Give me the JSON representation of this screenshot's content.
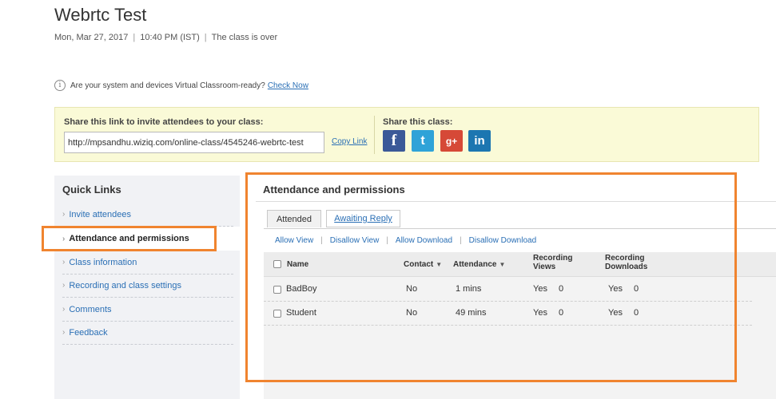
{
  "header": {
    "title": "Webrtc Test",
    "date": "Mon, Mar 27, 2017",
    "time": "10:40 PM (IST)",
    "status": "The class is over",
    "separator": "|"
  },
  "readiness": {
    "info_glyph": "i",
    "text": "Are your system and devices Virtual Classroom-ready?",
    "link": "Check Now"
  },
  "share": {
    "invite_label": "Share this link to invite attendees to your class:",
    "link_value": "http://mpsandhu.wiziq.com/online-class/4545246-webrtc-test",
    "copy_label": "Copy Link",
    "share_class_label": "Share this class:",
    "social": [
      {
        "name": "facebook",
        "glyph": "f",
        "color": "#3b5998"
      },
      {
        "name": "twitter",
        "glyph": "t",
        "color": "#2fa3d8"
      },
      {
        "name": "google-plus",
        "glyph": "g+",
        "color": "#d64937"
      },
      {
        "name": "linkedin",
        "glyph": "in",
        "color": "#1c76b1"
      }
    ]
  },
  "quick_links": {
    "title": "Quick Links",
    "items": [
      {
        "label": "Invite attendees"
      },
      {
        "label": "Attendance and permissions",
        "active": true
      },
      {
        "label": "Class information"
      },
      {
        "label": "Recording and class settings"
      },
      {
        "label": "Comments"
      },
      {
        "label": "Feedback"
      }
    ]
  },
  "panel": {
    "title": "Attendance and permissions",
    "tabs": [
      {
        "label": "Attended",
        "active": true
      },
      {
        "label": "Awaiting Reply",
        "active": false
      }
    ],
    "actions": [
      "Allow View",
      "Disallow View",
      "Allow Download",
      "Disallow Download"
    ],
    "columns": {
      "name": "Name",
      "contact": "Contact",
      "attendance": "Attendance",
      "rec_views_1": "Recording",
      "rec_views_2": "Views",
      "rec_downloads_1": "Recording",
      "rec_downloads_2": "Downloads"
    },
    "rows": [
      {
        "name": "BadBoy",
        "contact": "No",
        "attendance": "1 mins",
        "views_allowed": "Yes",
        "views_count": "0",
        "downloads_allowed": "Yes",
        "downloads_count": "0"
      },
      {
        "name": "Student",
        "contact": "No",
        "attendance": "49 mins",
        "views_allowed": "Yes",
        "views_count": "0",
        "downloads_allowed": "Yes",
        "downloads_count": "0"
      }
    ]
  },
  "colors": {
    "highlight": "#f0842f",
    "link": "#2a6fb5",
    "share_bg": "#fafad7"
  }
}
